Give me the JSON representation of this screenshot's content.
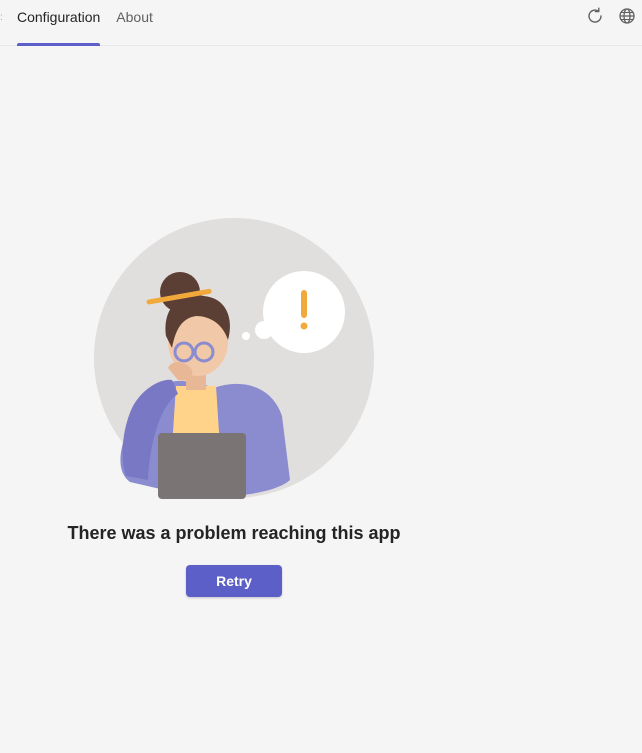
{
  "tabs": [
    {
      "label": "Configuration",
      "active": true
    },
    {
      "label": "About",
      "active": false
    }
  ],
  "icons": {
    "refresh": "refresh-icon",
    "globe": "globe-icon"
  },
  "error": {
    "message": "There was a problem reaching this app",
    "retry_label": "Retry"
  },
  "colors": {
    "accent": "#5b5fc7",
    "background": "#f5f5f5",
    "warning": "#f2a93b"
  }
}
